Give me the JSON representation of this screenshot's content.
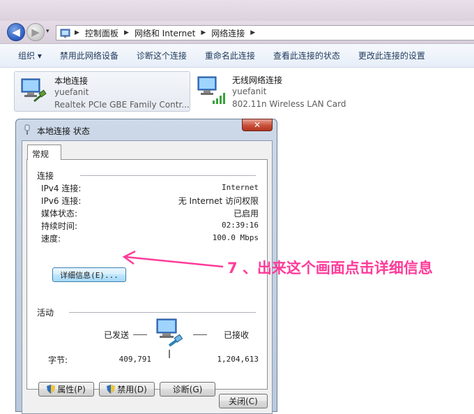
{
  "address": {
    "crumbs": [
      "控制面板",
      "网络和 Internet",
      "网络连接"
    ]
  },
  "toolbar": {
    "items": [
      "组织 ▾",
      "禁用此网络设备",
      "诊断这个连接",
      "重命名此连接",
      "查看此连接的状态",
      "更改此连接的设置"
    ]
  },
  "adapters": [
    {
      "name": "本地连接",
      "network": "yuefanit",
      "device": "Realtek PCIe GBE Family Contr..."
    },
    {
      "name": "无线网络连接",
      "network": "yuefanit",
      "device": "802.11n Wireless LAN Card"
    }
  ],
  "dialog": {
    "title": "本地连接 状态",
    "close_glyph": "✕",
    "tab": "常规",
    "connection": {
      "heading": "连接",
      "rows": [
        {
          "label": "IPv4 连接:",
          "value": "Internet"
        },
        {
          "label": "IPv6 连接:",
          "value": "无 Internet 访问权限"
        },
        {
          "label": "媒体状态:",
          "value": "已启用"
        },
        {
          "label": "持续时间:",
          "value": "02:39:16"
        },
        {
          "label": "速度:",
          "value": "100.0 Mbps"
        }
      ],
      "details_button": "详细信息(E)..."
    },
    "activity": {
      "heading": "活动",
      "sent_label": "已发送",
      "received_label": "已接收",
      "bytes_label": "字节:",
      "bytes_sent": "409,791",
      "bytes_received": "1,204,613"
    },
    "buttons": {
      "properties": "属性(P)",
      "disable": "禁用(D)",
      "diagnose": "诊断(G)",
      "close": "关闭(C)"
    }
  },
  "annotation": {
    "text": "7 、出来这个画面点击详细信息",
    "color": "#ff3b9a"
  },
  "icons": [
    "network-folder-icon",
    "computer-network-icon",
    "wireless-signal-icon",
    "shield-icon",
    "network-activity-icon"
  ]
}
